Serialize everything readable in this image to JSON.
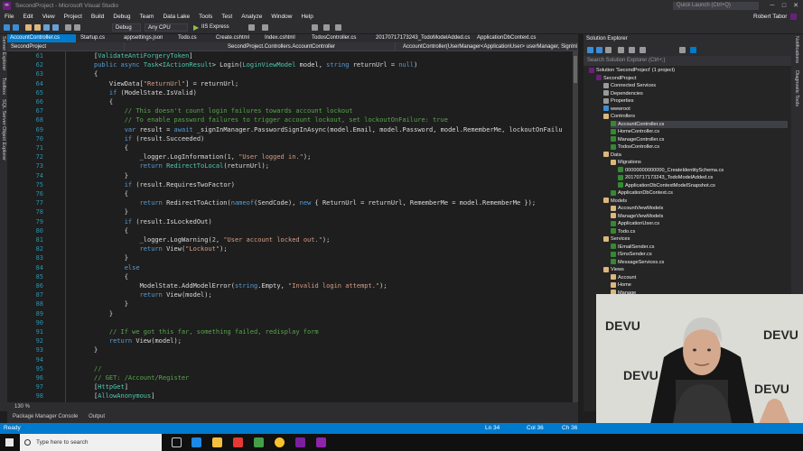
{
  "window": {
    "title": "SecondProject - Microsoft Visual Studio",
    "quick_launch": "Quick Launch (Ctrl+Q)",
    "user": "Robert Tabor"
  },
  "menu": [
    "File",
    "Edit",
    "View",
    "Project",
    "Build",
    "Debug",
    "Team",
    "Data Lake",
    "Tools",
    "Test",
    "Analyze",
    "Window",
    "Help"
  ],
  "toolbar": {
    "config": "Debug",
    "platform": "Any CPU",
    "run_target": "IIS Express"
  },
  "tabs": [
    "AccountController.cs",
    "Startup.cs",
    "appsettings.json",
    "Todo.cs",
    "Create.cshtml",
    "Index.cshtml",
    "TodosController.cs",
    "20170717173243_TodoModelAdded.cs",
    "ApplicationDbContext.cs"
  ],
  "nav": {
    "project": "SecondProject",
    "class": "SecondProject.Controllers.AccountController",
    "member": "AccountController(UserManager<ApplicationUser> userManager, SignInMa"
  },
  "side_labels": [
    "Server Explorer",
    "Toolbox",
    "SQL Server Object Explorer"
  ],
  "right_labels": [
    "Notifications",
    "Diagnostic Tools"
  ],
  "code": [
    {
      "n": "61",
      "t": "        [ValidateAntiForgeryToken]"
    },
    {
      "n": "62",
      "t": "        public async Task<IActionResult> Login(LoginViewModel model, string returnUrl = null)"
    },
    {
      "n": "63",
      "t": "        {"
    },
    {
      "n": "64",
      "t": "            ViewData[\"ReturnUrl\"] = returnUrl;"
    },
    {
      "n": "65",
      "t": "            if (ModelState.IsValid)"
    },
    {
      "n": "66",
      "t": "            {"
    },
    {
      "n": "67",
      "t": "                // This doesn't count login failures towards account lockout"
    },
    {
      "n": "68",
      "t": "                // To enable password failures to trigger account lockout, set lockoutOnFailure: true"
    },
    {
      "n": "69",
      "t": "                var result = await _signInManager.PasswordSignInAsync(model.Email, model.Password, model.RememberMe, lockoutOnFailu"
    },
    {
      "n": "70",
      "t": "                if (result.Succeeded)"
    },
    {
      "n": "71",
      "t": "                {"
    },
    {
      "n": "72",
      "t": "                    _logger.LogInformation(1, \"User logged in.\");"
    },
    {
      "n": "73",
      "t": "                    return RedirectToLocal(returnUrl);"
    },
    {
      "n": "74",
      "t": "                }"
    },
    {
      "n": "75",
      "t": "                if (result.RequiresTwoFactor)"
    },
    {
      "n": "76",
      "t": "                {"
    },
    {
      "n": "77",
      "t": "                    return RedirectToAction(nameof(SendCode), new { ReturnUrl = returnUrl, RememberMe = model.RememberMe });"
    },
    {
      "n": "78",
      "t": "                }"
    },
    {
      "n": "79",
      "t": "                if (result.IsLockedOut)"
    },
    {
      "n": "80",
      "t": "                {"
    },
    {
      "n": "81",
      "t": "                    _logger.LogWarning(2, \"User account locked out.\");"
    },
    {
      "n": "82",
      "t": "                    return View(\"Lockout\");"
    },
    {
      "n": "83",
      "t": "                }"
    },
    {
      "n": "84",
      "t": "                else"
    },
    {
      "n": "85",
      "t": "                {"
    },
    {
      "n": "86",
      "t": "                    ModelState.AddModelError(string.Empty, \"Invalid login attempt.\");"
    },
    {
      "n": "87",
      "t": "                    return View(model);"
    },
    {
      "n": "88",
      "t": "                }"
    },
    {
      "n": "89",
      "t": "            }"
    },
    {
      "n": "90",
      "t": ""
    },
    {
      "n": "91",
      "t": "            // If we got this far, something failed, redisplay form"
    },
    {
      "n": "92",
      "t": "            return View(model);"
    },
    {
      "n": "93",
      "t": "        }"
    },
    {
      "n": "94",
      "t": ""
    },
    {
      "n": "95",
      "t": "        //"
    },
    {
      "n": "96",
      "t": "        // GET: /Account/Register"
    },
    {
      "n": "97",
      "t": "        [HttpGet]"
    },
    {
      "n": "98",
      "t": "        [AllowAnonymous]"
    }
  ],
  "zoom": "130 %",
  "panels": [
    "Package Manager Console",
    "Output"
  ],
  "solution_explorer": {
    "title": "Solution Explorer",
    "search": "Search Solution Explorer (Ctrl+;)",
    "items": [
      {
        "label": "Solution 'SecondProject' (1 project)",
        "icon": "proj",
        "lvl": 0
      },
      {
        "label": "SecondProject",
        "icon": "proj",
        "lvl": 1
      },
      {
        "label": "Connected Services",
        "icon": "gear",
        "lvl": 2
      },
      {
        "label": "Dependencies",
        "icon": "gear",
        "lvl": 2
      },
      {
        "label": "Properties",
        "icon": "gear",
        "lvl": 2
      },
      {
        "label": "wwwroot",
        "icon": "glob",
        "lvl": 2
      },
      {
        "label": "Controllers",
        "icon": "folder",
        "lvl": 2
      },
      {
        "label": "AccountController.cs",
        "icon": "cs",
        "lvl": 3,
        "sel": true
      },
      {
        "label": "HomeController.cs",
        "icon": "cs",
        "lvl": 3
      },
      {
        "label": "ManageController.cs",
        "icon": "cs",
        "lvl": 3
      },
      {
        "label": "TodosController.cs",
        "icon": "cs",
        "lvl": 3
      },
      {
        "label": "Data",
        "icon": "folder",
        "lvl": 2
      },
      {
        "label": "Migrations",
        "icon": "folder",
        "lvl": 3
      },
      {
        "label": "00000000000000_CreateIdentitySchema.cs",
        "icon": "cs",
        "lvl": 4
      },
      {
        "label": "20170717173243_TodoModelAdded.cs",
        "icon": "cs",
        "lvl": 4
      },
      {
        "label": "ApplicationDbContextModelSnapshot.cs",
        "icon": "cs",
        "lvl": 4
      },
      {
        "label": "ApplicationDbContext.cs",
        "icon": "cs",
        "lvl": 3
      },
      {
        "label": "Models",
        "icon": "folder",
        "lvl": 2
      },
      {
        "label": "AccountViewModels",
        "icon": "folder",
        "lvl": 3
      },
      {
        "label": "ManageViewModels",
        "icon": "folder",
        "lvl": 3
      },
      {
        "label": "ApplicationUser.cs",
        "icon": "cs",
        "lvl": 3
      },
      {
        "label": "Todo.cs",
        "icon": "cs",
        "lvl": 3
      },
      {
        "label": "Services",
        "icon": "folder",
        "lvl": 2
      },
      {
        "label": "IEmailSender.cs",
        "icon": "cs",
        "lvl": 3
      },
      {
        "label": "ISmsSender.cs",
        "icon": "cs",
        "lvl": 3
      },
      {
        "label": "MessageServices.cs",
        "icon": "cs",
        "lvl": 3
      },
      {
        "label": "Views",
        "icon": "folder",
        "lvl": 2
      },
      {
        "label": "Account",
        "icon": "folder",
        "lvl": 3
      },
      {
        "label": "Home",
        "icon": "folder",
        "lvl": 3
      },
      {
        "label": "Manage",
        "icon": "folder",
        "lvl": 3
      },
      {
        "label": "Shared",
        "icon": "folder",
        "lvl": 3
      }
    ]
  },
  "status": {
    "left": "Ready",
    "ln": "Ln 34",
    "col": "Col 36",
    "ch": "Ch 36"
  },
  "taskbar": {
    "search": "Type here to search"
  },
  "webcam": {
    "logo_text": "DEVU"
  },
  "colors": {
    "accent": "#007acc",
    "vs_purple": "#68217a"
  }
}
